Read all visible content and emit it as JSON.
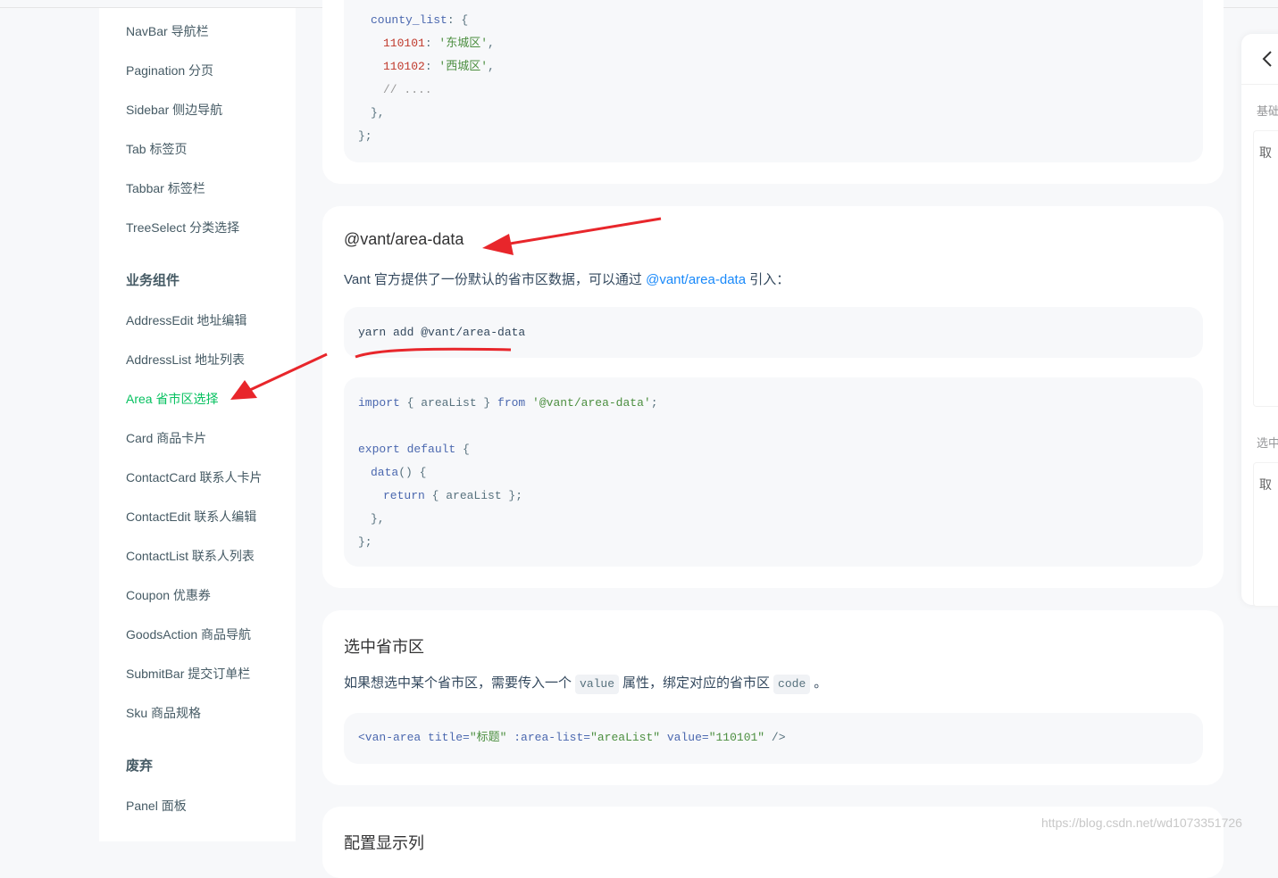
{
  "sidebar": {
    "items_top": [
      {
        "label": "NavBar 导航栏"
      },
      {
        "label": "Pagination 分页"
      },
      {
        "label": "Sidebar 侧边导航"
      },
      {
        "label": "Tab 标签页"
      },
      {
        "label": "Tabbar 标签栏"
      },
      {
        "label": "TreeSelect 分类选择"
      }
    ],
    "group_business": "业务组件",
    "items_business": [
      {
        "label": "AddressEdit 地址编辑"
      },
      {
        "label": "AddressList 地址列表"
      },
      {
        "label": "Area 省市区选择",
        "active": true
      },
      {
        "label": "Card 商品卡片"
      },
      {
        "label": "ContactCard 联系人卡片"
      },
      {
        "label": "ContactEdit 联系人编辑"
      },
      {
        "label": "ContactList 联系人列表"
      },
      {
        "label": "Coupon 优惠券"
      },
      {
        "label": "GoodsAction 商品导航"
      },
      {
        "label": "SubmitBar 提交订单栏"
      },
      {
        "label": "Sku 商品规格"
      }
    ],
    "group_deprecated": "废弃",
    "items_deprecated": [
      {
        "label": "Panel 面板"
      }
    ]
  },
  "card1": {
    "code_lines": {
      "l1_key": "county_list",
      "l1_rest": ": {",
      "l2_num": "110101",
      "l2_sep": ": ",
      "l2_str": "'东城区'",
      "l2_end": ",",
      "l3_num": "110102",
      "l3_sep": ": ",
      "l3_str": "'西城区'",
      "l3_end": ",",
      "l4": "// ....",
      "l5": "},",
      "l6": "};"
    }
  },
  "card2": {
    "title": "@vant/area-data",
    "desc_before": "Vant 官方提供了一份默认的省市区数据，可以通过 ",
    "desc_link": "@vant/area-data",
    "desc_after": " 引入：",
    "install_cmd": "yarn add @vant/area-data",
    "import_kw": "import",
    "import_mid": " { areaList } ",
    "import_from": "from",
    "import_src": " '@vant/area-data'",
    "import_end": ";",
    "export_kw": "export default",
    "export_end": " {",
    "data_fn": "data",
    "data_rest": "() {",
    "return_kw": "return",
    "return_rest": " { areaList };",
    "close1": "},",
    "close2": "};"
  },
  "card3": {
    "title": "选中省市区",
    "desc_a": "如果想选中某个省市区，需要传入一个",
    "desc_code1": "value",
    "desc_b": "属性，绑定对应的省市区",
    "desc_code2": "code",
    "desc_c": "。",
    "tag_open": "<van-area",
    "attr1": " title=",
    "val1": "\"标题\"",
    "attr2": " :area-list=",
    "val2": "\"areaList\"",
    "attr3": " value=",
    "val3": "\"110101\"",
    "tag_close": " />"
  },
  "card4": {
    "title": "配置显示列"
  },
  "simulator": {
    "back_icon": "chevron-left-icon",
    "label1": "基础",
    "box1_text": "取",
    "label2": "选中",
    "box2_text": "取"
  },
  "watermark": "https://blog.csdn.net/wd1073351726",
  "colors": {
    "active": "#07c160",
    "annotation_red": "#e8262b",
    "link": "#1989fa"
  }
}
